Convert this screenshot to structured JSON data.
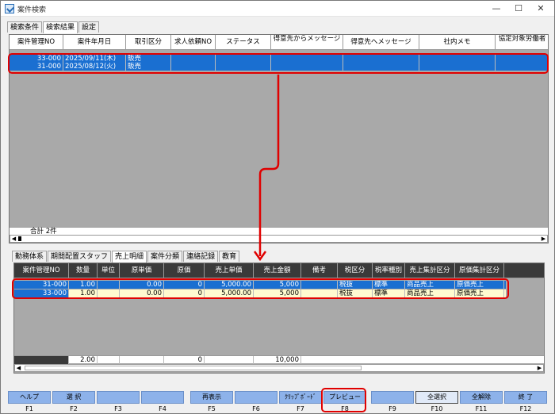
{
  "window": {
    "title": "案件検索",
    "minimize": "—",
    "maximize": "☐",
    "close": "✕"
  },
  "top_tabs": [
    "検索条件",
    "検索結果",
    "設定"
  ],
  "top_grid": {
    "headers": [
      "案件管理NO",
      "案件年月日",
      "取引区分",
      "求人依頼NO",
      "ステータス",
      "得意先からメッセージ",
      "得意先へメッセージ",
      "社内メモ",
      "協定対象労働者"
    ],
    "rows": [
      {
        "no": "33-000",
        "date": "2025/09/11(木)",
        "kubun": "販売"
      },
      {
        "no": "31-000",
        "date": "2025/08/12(火)",
        "kubun": "販売"
      }
    ],
    "footer": "合計 2件"
  },
  "bottom_tabs": [
    "勤務体系",
    "期間配置スタッフ",
    "売上明細",
    "案件分類",
    "連絡記録",
    "教育"
  ],
  "bottom_grid": {
    "headers": [
      "案件管理NO",
      "数量",
      "単位",
      "原単価",
      "原価",
      "売上単価",
      "売上金額",
      "備考",
      "税区分",
      "税率種別",
      "売上集計区分",
      "原価集計区分"
    ],
    "rows": [
      {
        "no": "31-000",
        "qty": "1.00",
        "unit": "",
        "gentanka": "0.00",
        "genka": "0",
        "uritanka": "5,000.00",
        "urikingaku": "5,000",
        "biko": "",
        "zei": "税抜",
        "zeiritsu": "標準",
        "urishukei": "商品売上",
        "genshukei": "原価売上"
      },
      {
        "no": "33-000",
        "qty": "1.00",
        "unit": "",
        "gentanka": "0.00",
        "genka": "0",
        "uritanka": "5,000.00",
        "urikingaku": "5,000",
        "biko": "",
        "zei": "税抜",
        "zeiritsu": "標準",
        "urishukei": "商品売上",
        "genshukei": "原価売上"
      }
    ],
    "totals": {
      "qty": "2.00",
      "genka": "0",
      "urikingaku": "10,000"
    }
  },
  "fkeys": [
    {
      "label": "ヘルプ",
      "key": "F1"
    },
    {
      "label": "選 択",
      "key": "F2"
    },
    {
      "label": "",
      "key": "F3"
    },
    {
      "label": "",
      "key": "F4"
    },
    {
      "label": "再表示",
      "key": "F5"
    },
    {
      "label": "",
      "key": "F6"
    },
    {
      "label": "ｸﾘｯﾌﾟﾎﾞｰﾄﾞ",
      "key": "F7"
    },
    {
      "label": "プレビュー",
      "key": "F8"
    },
    {
      "label": "",
      "key": "F9"
    },
    {
      "label": "全選択",
      "key": "F10"
    },
    {
      "label": "全解除",
      "key": "F11"
    },
    {
      "label": "終 了",
      "key": "F12"
    }
  ],
  "colors": {
    "selection": "#1a6fd1",
    "highlight": "#e00000",
    "fkey": "#8db2ea",
    "row_yellow": "#fffbd0"
  }
}
